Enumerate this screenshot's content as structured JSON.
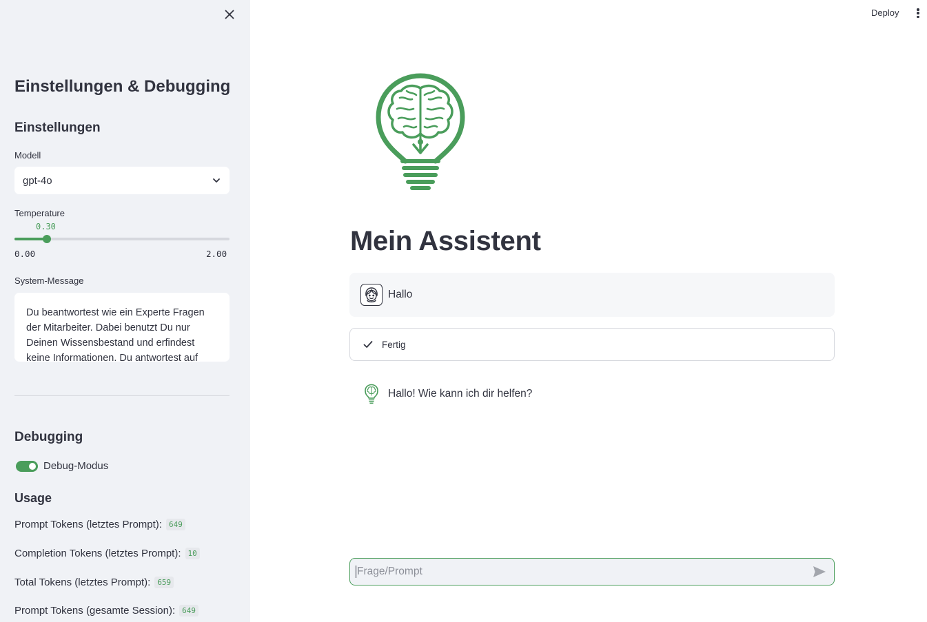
{
  "sidebar": {
    "title": "Einstellungen & Debugging",
    "settings_heading": "Einstellungen",
    "model_label": "Modell",
    "model_value": "gpt-4o",
    "temperature_label": "Temperature",
    "temperature_value": "0.30",
    "temperature_min": "0.00",
    "temperature_max": "2.00",
    "temperature_fraction": 0.15,
    "system_message_label": "System-Message",
    "system_message_value": "Du beantwortest wie ein Experte Fragen der Mitarbeiter. Dabei benutzt Du nur Deinen Wissensbestand und erfindest keine Informationen. Du antwortest auf",
    "debugging_heading": "Debugging",
    "debug_toggle_label": "Debug-Modus",
    "debug_toggle_on": true,
    "usage_heading": "Usage",
    "usage": [
      {
        "label": "Prompt Tokens (letztes Prompt):",
        "value": "649"
      },
      {
        "label": "Completion Tokens (letztes Prompt):",
        "value": "10"
      },
      {
        "label": "Total Tokens (letztes Prompt):",
        "value": "659"
      },
      {
        "label": "Prompt Tokens (gesamte Session):",
        "value": "649"
      }
    ]
  },
  "header": {
    "deploy_label": "Deploy"
  },
  "main": {
    "title": "Mein Assistent",
    "messages": {
      "user_text": "Hallo",
      "status_text": "Fertig",
      "assistant_text": "Hallo! Wie kann ich dir helfen?"
    },
    "input_placeholder": "Frage/Prompt"
  },
  "colors": {
    "accent": "#4a9d5b",
    "sidebar_bg": "#f0f2f6",
    "text": "#31333f"
  },
  "icons": {
    "close": "close-icon",
    "chevron": "chevron-down-icon",
    "menu": "kebab-menu-icon",
    "check": "check-icon",
    "send": "send-icon",
    "logo": "brain-lightbulb-logo",
    "user_avatar": "user-face-icon",
    "bot_avatar": "bot-lightbulb-icon"
  }
}
